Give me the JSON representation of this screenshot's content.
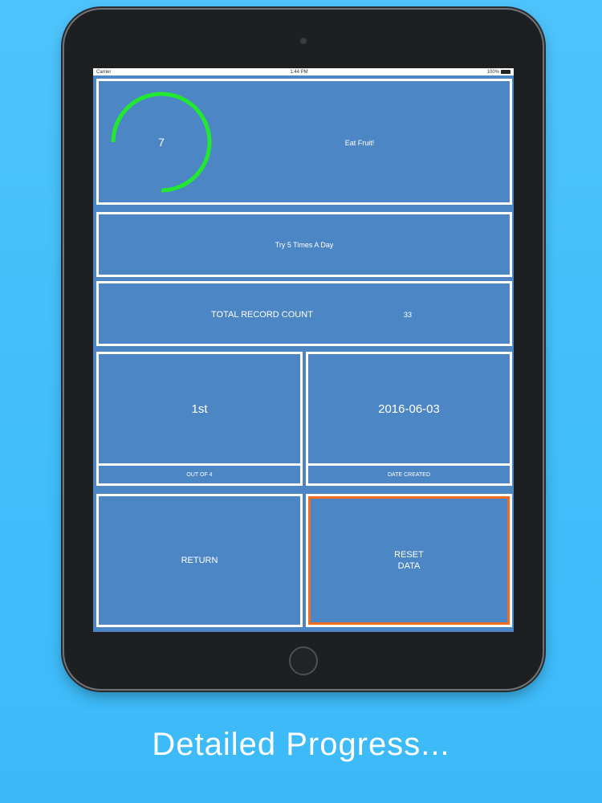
{
  "statusbar": {
    "carrier": "Carrier",
    "time": "1:44 PM",
    "battery": "100%"
  },
  "goal": {
    "count": "7",
    "progress_fraction": 0.75,
    "name": "Eat Fruit!"
  },
  "instruction": "Try 5 Times A Day",
  "total": {
    "label": "TOTAL RECORD COUNT",
    "value": "33"
  },
  "rank": {
    "value": "1st",
    "caption": "OUT OF 4"
  },
  "created": {
    "value": "2016-06-03",
    "caption": "DATE CREATED"
  },
  "buttons": {
    "return_label": "RETURN",
    "reset_label": "RESET\nDATA"
  },
  "caption": "Detailed Progress...",
  "colors": {
    "ring": "#22e832",
    "accent": "#f06c1f",
    "panel": "#4d86c4"
  }
}
